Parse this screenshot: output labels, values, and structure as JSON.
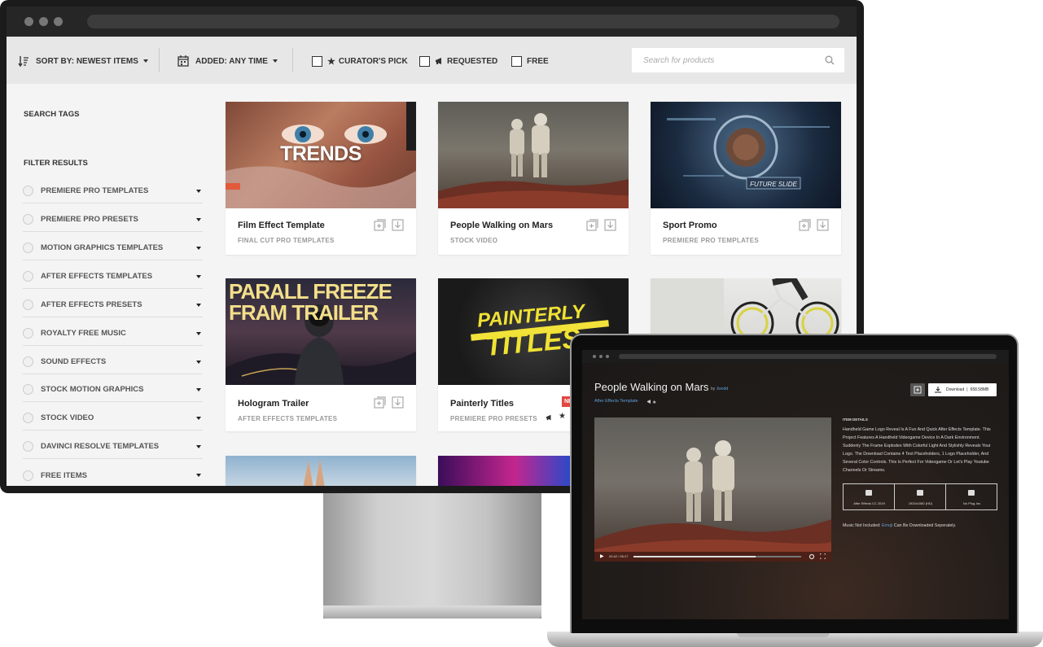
{
  "toolbar": {
    "sort_label": "SORT BY: NEWEST ITEMS",
    "added_label": "ADDED: ANY TIME",
    "curators_pick": "CURATOR'S PICK",
    "requested": "REQUESTED",
    "free": "FREE",
    "search_placeholder": "Search for products"
  },
  "sidebar": {
    "search_tags": "SEARCH TAGS",
    "filter_results": "FILTER RESULTS",
    "filters": [
      "PREMIERE PRO TEMPLATES",
      "PREMIERE PRO PRESETS",
      "MOTION GRAPHICS TEMPLATES",
      "AFTER EFFECTS TEMPLATES",
      "AFTER EFFECTS PRESETS",
      "ROYALTY FREE MUSIC",
      "SOUND EFFECTS",
      "STOCK MOTION GRAPHICS",
      "STOCK VIDEO",
      "DAVINCI RESOLVE TEMPLATES",
      "FREE ITEMS"
    ]
  },
  "cards": [
    {
      "title": "Film Effect Template",
      "category": "FINAL CUT PRO TEMPLATES",
      "thumb_text": "TRENDS"
    },
    {
      "title": "People Walking on Mars",
      "category": "STOCK VIDEO"
    },
    {
      "title": "Sport Promo",
      "category": "PREMIERE PRO TEMPLATES",
      "thumb_text": "FUTURE SLIDE"
    },
    {
      "title": "Hologram Trailer",
      "category": "AFTER EFFECTS TEMPLATES",
      "thumb_line1": "PARALL FREEZE",
      "thumb_line2": "FRAM TRAILER"
    },
    {
      "title": "Painterly Titles",
      "category": "PREMIERE PRO PRESETS",
      "thumb_line1": "PAINTERLY",
      "thumb_line2": "TITLES",
      "badge": "NE"
    }
  ],
  "laptop": {
    "title": "People Walking on Mars",
    "by": "by",
    "author": "Jwodd",
    "category_link": "After Effects Template",
    "download_label": "Download",
    "download_size": "658.58MB",
    "item_details_label": "ITEM DETAILS",
    "description": "Handheld Game Logo Reveal Is A Fun And Quick After Effects Template. This Project Features A Handheld Videogame Device In A Dark Environment. Suddenly The Frame Explodes With Colorful Light And Stylishly Reveals Your Logo. The Download Contains 4 Text Placeholders, 1 Logo Placeholder, And Several Color Controls. This Is Perfect For Videogame Or Let's Play Youtube Channels Or Streams.",
    "specs": [
      "After Effects CC 2019",
      "1920x1080 (HD)",
      "No Plug-Ins"
    ],
    "music_prefix": "Music Not Included:",
    "music_link": "Emoji",
    "music_suffix": "Can Be Downloaded Seperately.",
    "video_time": "00:42 / 06:17",
    "video_progress": 0.73
  },
  "colors": {
    "badge": "#e2473f",
    "link": "#5ea0d8"
  }
}
